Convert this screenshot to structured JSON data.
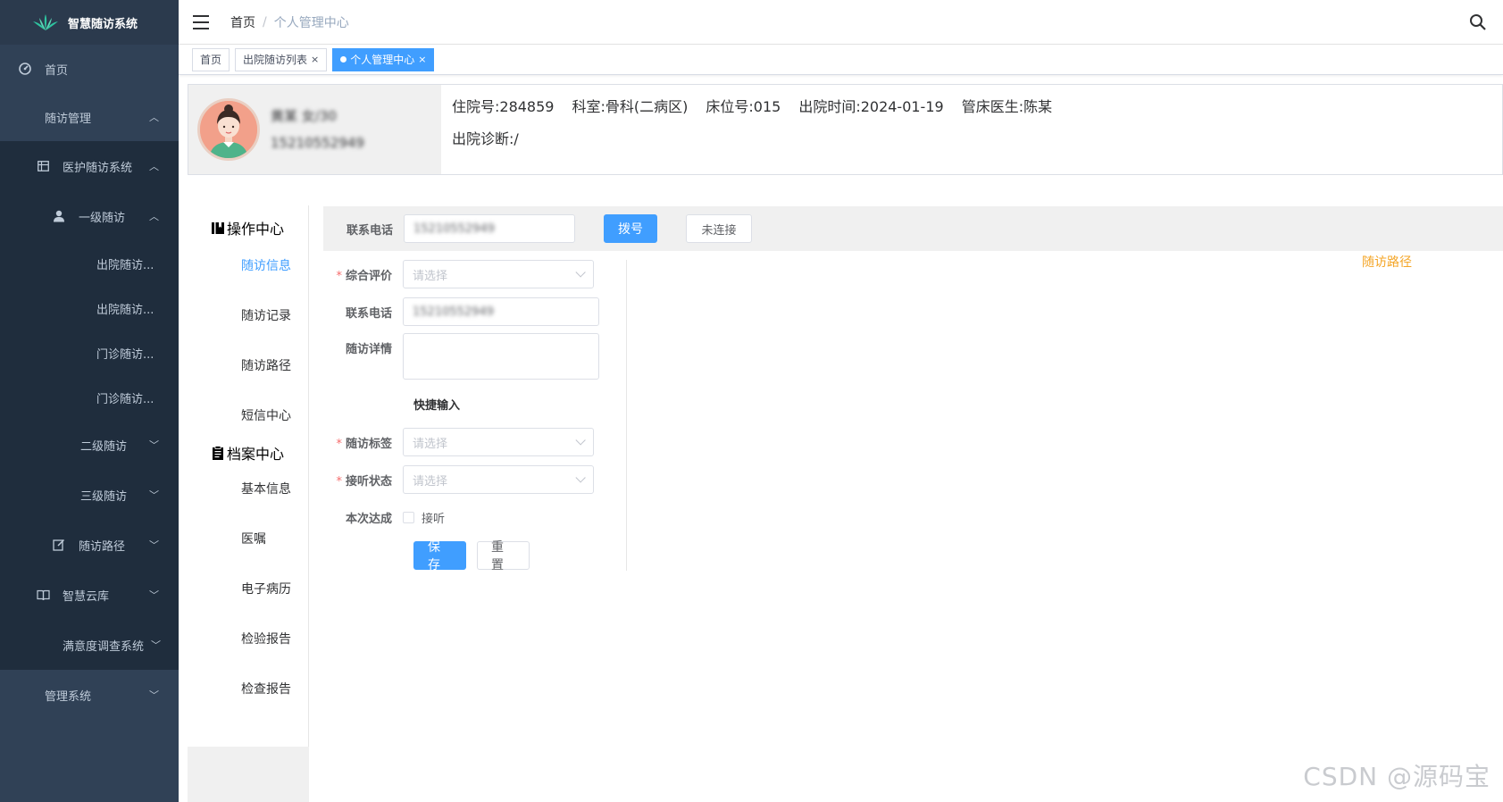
{
  "app": {
    "title": "智慧随访系统"
  },
  "sidebar": {
    "items": [
      {
        "label": "首页"
      },
      {
        "label": "随访管理"
      },
      {
        "label": "医护随访系统"
      },
      {
        "label": "一级随访"
      },
      {
        "label": "出院随访..."
      },
      {
        "label": "出院随访..."
      },
      {
        "label": "门诊随访..."
      },
      {
        "label": "门诊随访..."
      },
      {
        "label": "二级随访"
      },
      {
        "label": "三级随访"
      },
      {
        "label": "随访路径"
      },
      {
        "label": "智慧云库"
      },
      {
        "label": "满意度调查系统"
      },
      {
        "label": "管理系统"
      }
    ]
  },
  "breadcrumb": {
    "home": "首页",
    "sep": "/",
    "current": "个人管理中心"
  },
  "tags": [
    {
      "label": "首页"
    },
    {
      "label": "出院随访列表",
      "close": "×"
    },
    {
      "label": "个人管理中心",
      "close": "×"
    }
  ],
  "patient": {
    "name_age": "黄某 女/30",
    "phone": "15210552949",
    "admission_no": "住院号:284859",
    "department": "科室:骨科(二病区)",
    "bed_no": "床位号:015",
    "discharge_time": "出院时间:2024-01-19",
    "doctor": "管床医生:陈某",
    "diagnosis": "出院诊断:/"
  },
  "opnav": {
    "ops_title": "操作中心",
    "ops_items": [
      "随访信息",
      "随访记录",
      "随访路径",
      "短信中心"
    ],
    "archive_title": "档案中心",
    "archive_items": [
      "基本信息",
      "医嘱",
      "电子病历",
      "检验报告",
      "检查报告"
    ]
  },
  "phonebar": {
    "label": "联系电话",
    "value": "15210552949",
    "dial_button": "拨号",
    "status_button": "未连接"
  },
  "form": {
    "overall_rating": {
      "label": "综合评价",
      "placeholder": "请选择"
    },
    "contact_phone": {
      "label": "联系电话",
      "value": "15210552949"
    },
    "details": {
      "label": "随访详情"
    },
    "quick_input": "快捷输入",
    "tag": {
      "label": "随访标签",
      "placeholder": "请选择"
    },
    "answer_status": {
      "label": "接听状态",
      "placeholder": "请选择"
    },
    "achieved": {
      "label": "本次达成",
      "option": "接听"
    },
    "save_button": "保存",
    "reset_button": "重置"
  },
  "path_link": "随访路径",
  "watermark": "CSDN @源码宝"
}
